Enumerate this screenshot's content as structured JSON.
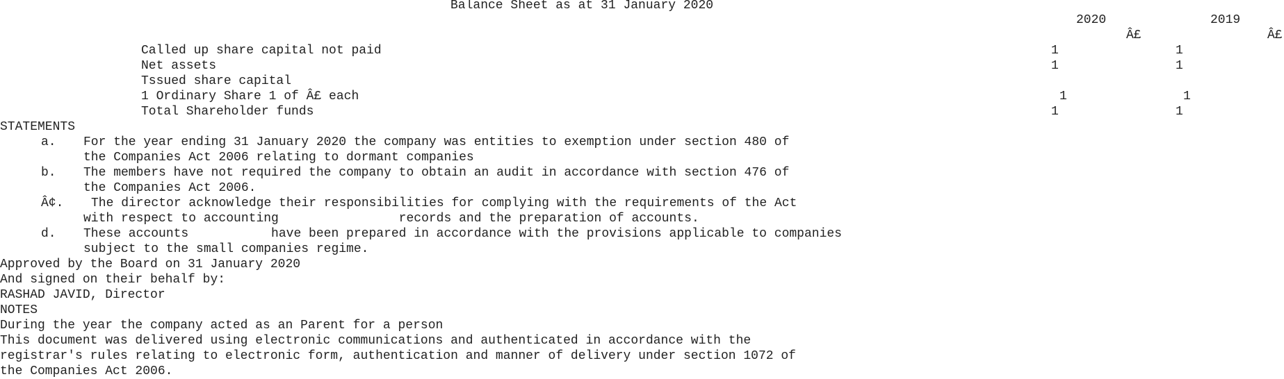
{
  "title": "Balance Sheet as at 31 January 2020",
  "columns": {
    "year_current": "2020",
    "year_prior": "2019",
    "currency_current": "Â£",
    "currency_prior": "Â£"
  },
  "balance_rows": [
    {
      "label": "Called up share capital not paid",
      "current": "1",
      "prior": "1"
    },
    {
      "label": "Net assets",
      "current": "1",
      "prior": "1"
    },
    {
      "label": "Tssued share capital",
      "current": "",
      "prior": ""
    },
    {
      "label": "1 Ordinary Share 1 of Â£ each",
      "current": "1",
      "prior": "1"
    },
    {
      "label": "Total Shareholder funds",
      "current": "1",
      "prior": "1"
    }
  ],
  "statements": {
    "heading": "STATEMENTS",
    "items": [
      {
        "marker": "a.",
        "line1": "For the year ending 31 January 2020 the company was entities to exemption under section 480 of",
        "line2": "the Companies Act 2006 relating to dormant companies"
      },
      {
        "marker": "b.",
        "line1": "The members have not required the company to obtain an audit in accordance with section 476 of",
        "line2": "the Companies Act 2006."
      },
      {
        "marker": "Â¢.",
        "line1": "The director acknowledge their responsibilities for complying with the requirements of the Act",
        "line2": "with respect to accounting                records and the preparation of accounts."
      },
      {
        "marker": "d.",
        "line1": "These accounts           have been prepared in accordance with the provisions applicable to companies",
        "line2": "subject to the small companies regime."
      }
    ]
  },
  "approval": {
    "line1": "Approved by the Board on 31 January 2020",
    "line2": "And signed on their behalf by:",
    "line3": "RASHAD JAVID, Director"
  },
  "notes": {
    "heading": "NOTES",
    "lines": [
      "During the year the company acted as an Parent for a person",
      "This document was delivered using electronic communications and authenticated in accordance with the",
      "registrar's rules relating to electronic form, authentication and manner of delivery under section 1072 of",
      "the Companies Act 2006."
    ]
  }
}
